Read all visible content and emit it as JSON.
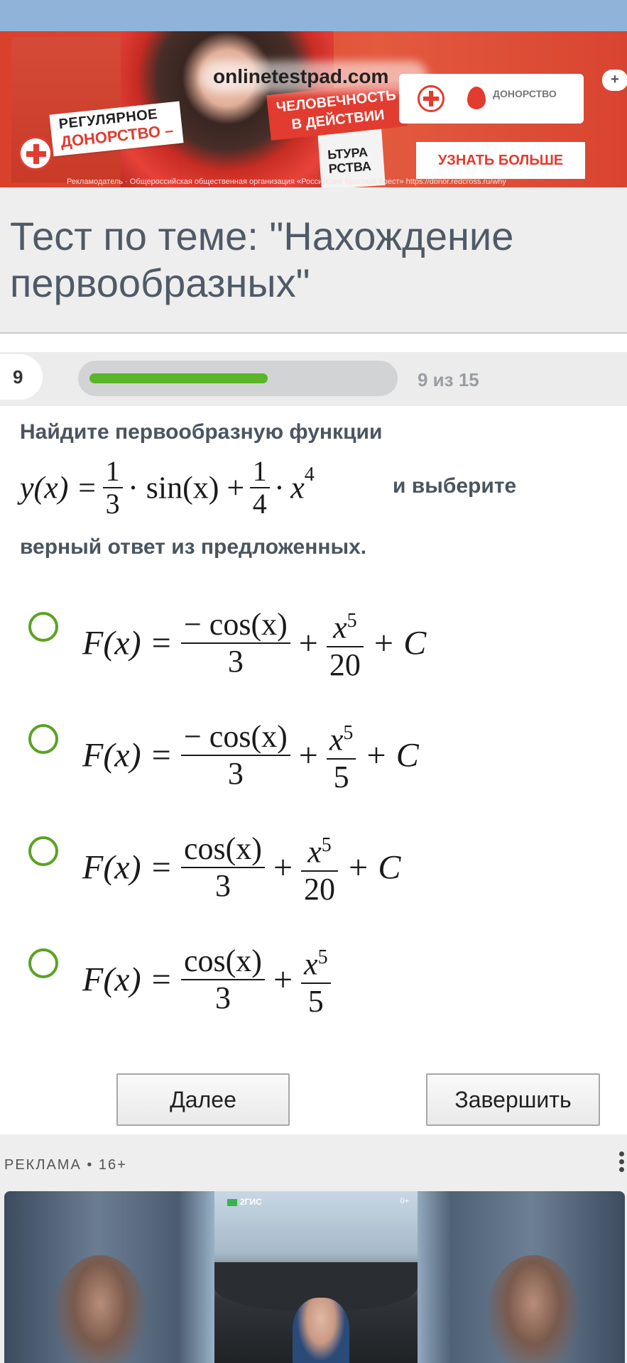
{
  "ad_top": {
    "site": "onlinetestpad.com",
    "regular_line1": "РЕГУЛЯРНОЕ",
    "regular_line2": "ДОНОРСТВО –",
    "humanity_line1": "ЧЕЛОВЕЧНОСТЬ",
    "humanity_line2": "В ДЕЙСТВИИ",
    "sign_line1": "ЬТУРА",
    "sign_line2": "РСТВА",
    "brand": "ДОНОРСТВО",
    "close": "+",
    "cta": "УЗНАТЬ БОЛЬШЕ",
    "disclaimer": "Рекламодатель · Общероссийская общественная организация «Российский Красный Крест» https://donor.redcross.ru/why",
    "colors": {
      "red": "#e23b2f"
    }
  },
  "title": "Тест по теме: \"Нахождение первообразных\"",
  "progress": {
    "number": "9",
    "text": "9 из 15",
    "value": 0.6,
    "color": "#5ab528"
  },
  "question": {
    "line1": "Найдите первообразную функции",
    "formula": {
      "lhs": "y(x) =",
      "f1_num": "1",
      "f1_den": "3",
      "mid": "· sin(x) +",
      "f2_num": "1",
      "f2_den": "4",
      "tail_var": "· x",
      "tail_exp": "4"
    },
    "tail": "и выберите",
    "line3": "верный ответ из предложенных."
  },
  "options": [
    {
      "lhs": "F(x) =",
      "f1_num": "− cos(x)",
      "f1_den": "3",
      "op": "+",
      "f2_num_var": "x",
      "f2_num_exp": "5",
      "f2_den": "20",
      "tail": "+ C"
    },
    {
      "lhs": "F(x) =",
      "f1_num": "− cos(x)",
      "f1_den": "3",
      "op": "+",
      "f2_num_var": "x",
      "f2_num_exp": "5",
      "f2_den": "5",
      "tail": "+ C"
    },
    {
      "lhs": "F(x) =",
      "f1_num": "cos(x)",
      "f1_den": "3",
      "op": "+",
      "f2_num_var": "x",
      "f2_num_exp": "5",
      "f2_den": "20",
      "tail": "+ C"
    },
    {
      "lhs": "F(x) =",
      "f1_num": "cos(x)",
      "f1_den": "3",
      "op": "+",
      "f2_num_var": "x",
      "f2_num_exp": "5",
      "f2_den": "5",
      "tail": ""
    }
  ],
  "buttons": {
    "next": "Далее",
    "finish": "Завершить"
  },
  "ad_bottom": {
    "label": "РЕКЛАМА • 16+",
    "brand": "2ГИС",
    "age": "0+"
  }
}
